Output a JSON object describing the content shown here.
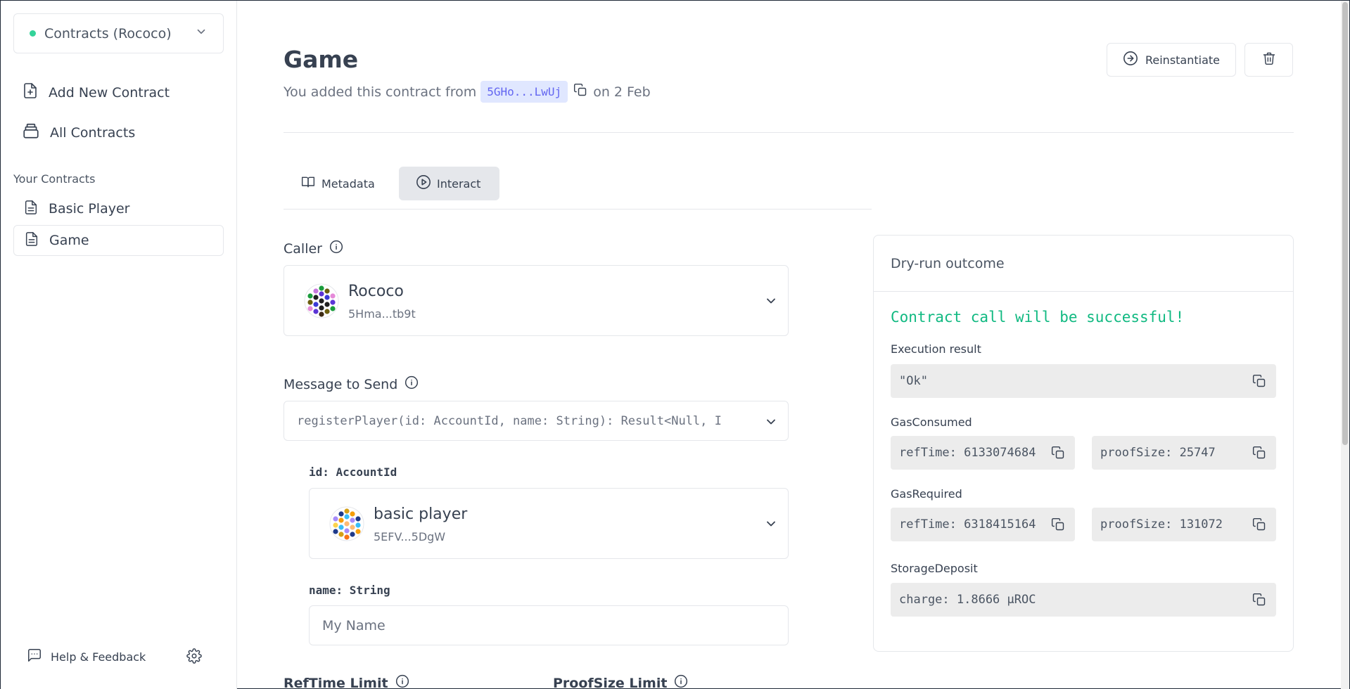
{
  "sidebar": {
    "network": "Contracts (Rococo)",
    "nav": [
      {
        "label": "Add New Contract",
        "icon": "file-plus-icon"
      },
      {
        "label": "All Contracts",
        "icon": "stack-icon"
      }
    ],
    "section_label": "Your Contracts",
    "contracts": [
      {
        "label": "Basic Player",
        "icon": "document-icon"
      },
      {
        "label": "Game",
        "icon": "document-icon"
      }
    ],
    "help_label": "Help & Feedback"
  },
  "header": {
    "title": "Game",
    "subtitle_prefix": "You added this contract from",
    "address": "5GHo...LwUj",
    "subtitle_suffix": "on 2 Feb",
    "reinstantiate_label": "Reinstantiate"
  },
  "tabs": [
    {
      "label": "Metadata",
      "icon": "book-icon"
    },
    {
      "label": "Interact",
      "icon": "play-circle-icon",
      "active": true
    }
  ],
  "form": {
    "caller_label": "Caller",
    "caller": {
      "name": "Rococo",
      "address": "5Hma...tb9t"
    },
    "message_label": "Message to Send",
    "message": "registerPlayer(id: AccountId, name: String): Result<Null, I",
    "args": {
      "id_label": "id: AccountId",
      "id_account": {
        "name": "basic player",
        "address": "5EFV...5DgW"
      },
      "name_label": "name: String",
      "name_value": "My Name"
    },
    "reftime_limit_label": "RefTime Limit",
    "proofsize_limit_label": "ProofSize Limit"
  },
  "dry_run": {
    "title": "Dry-run outcome",
    "success_message": "Contract call will be successful!",
    "execution_label": "Execution result",
    "execution_value": "\"Ok\"",
    "gas_consumed_label": "GasConsumed",
    "gas_consumed": {
      "ref_time": "refTime: 6133074684",
      "proof_size": "proofSize: 25747"
    },
    "gas_required_label": "GasRequired",
    "gas_required": {
      "ref_time": "refTime: 6318415164",
      "proof_size": "proofSize: 131072"
    },
    "storage_label": "StorageDeposit",
    "storage_value": "charge: 1.8666 µROC"
  },
  "colors": {
    "success": "#10b981",
    "network_dot": "#34d399",
    "address_pill_bg": "#e0e7ff",
    "address_pill_text": "#6366f1"
  }
}
